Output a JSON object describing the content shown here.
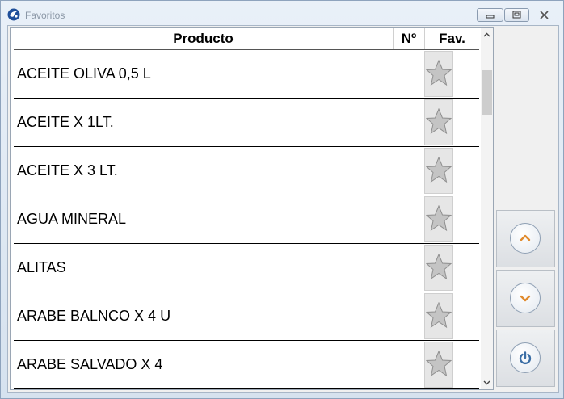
{
  "window": {
    "title": "Favoritos"
  },
  "table": {
    "columns": {
      "product": "Producto",
      "number": "Nº",
      "favorite": "Fav."
    },
    "rows": [
      {
        "product": "ACEITE OLIVA 0,5 L",
        "number": "",
        "favorite": false
      },
      {
        "product": "ACEITE X 1LT.",
        "number": "",
        "favorite": false
      },
      {
        "product": "ACEITE X 3 LT.",
        "number": "",
        "favorite": false
      },
      {
        "product": "AGUA MINERAL",
        "number": "",
        "favorite": false
      },
      {
        "product": "ALITAS",
        "number": "",
        "favorite": false
      },
      {
        "product": "ARABE BALNCO X 4 U",
        "number": "",
        "favorite": false
      },
      {
        "product": "ARABE SALVADO X 4",
        "number": "",
        "favorite": false
      }
    ]
  },
  "side_buttons": [
    {
      "icon": "chevron-up-icon"
    },
    {
      "icon": "chevron-down-icon"
    },
    {
      "icon": "power-icon"
    }
  ],
  "colors": {
    "accent_icon": "#e08a2c",
    "power_icon": "#3b6ea5",
    "star": "#b9b9b9"
  }
}
